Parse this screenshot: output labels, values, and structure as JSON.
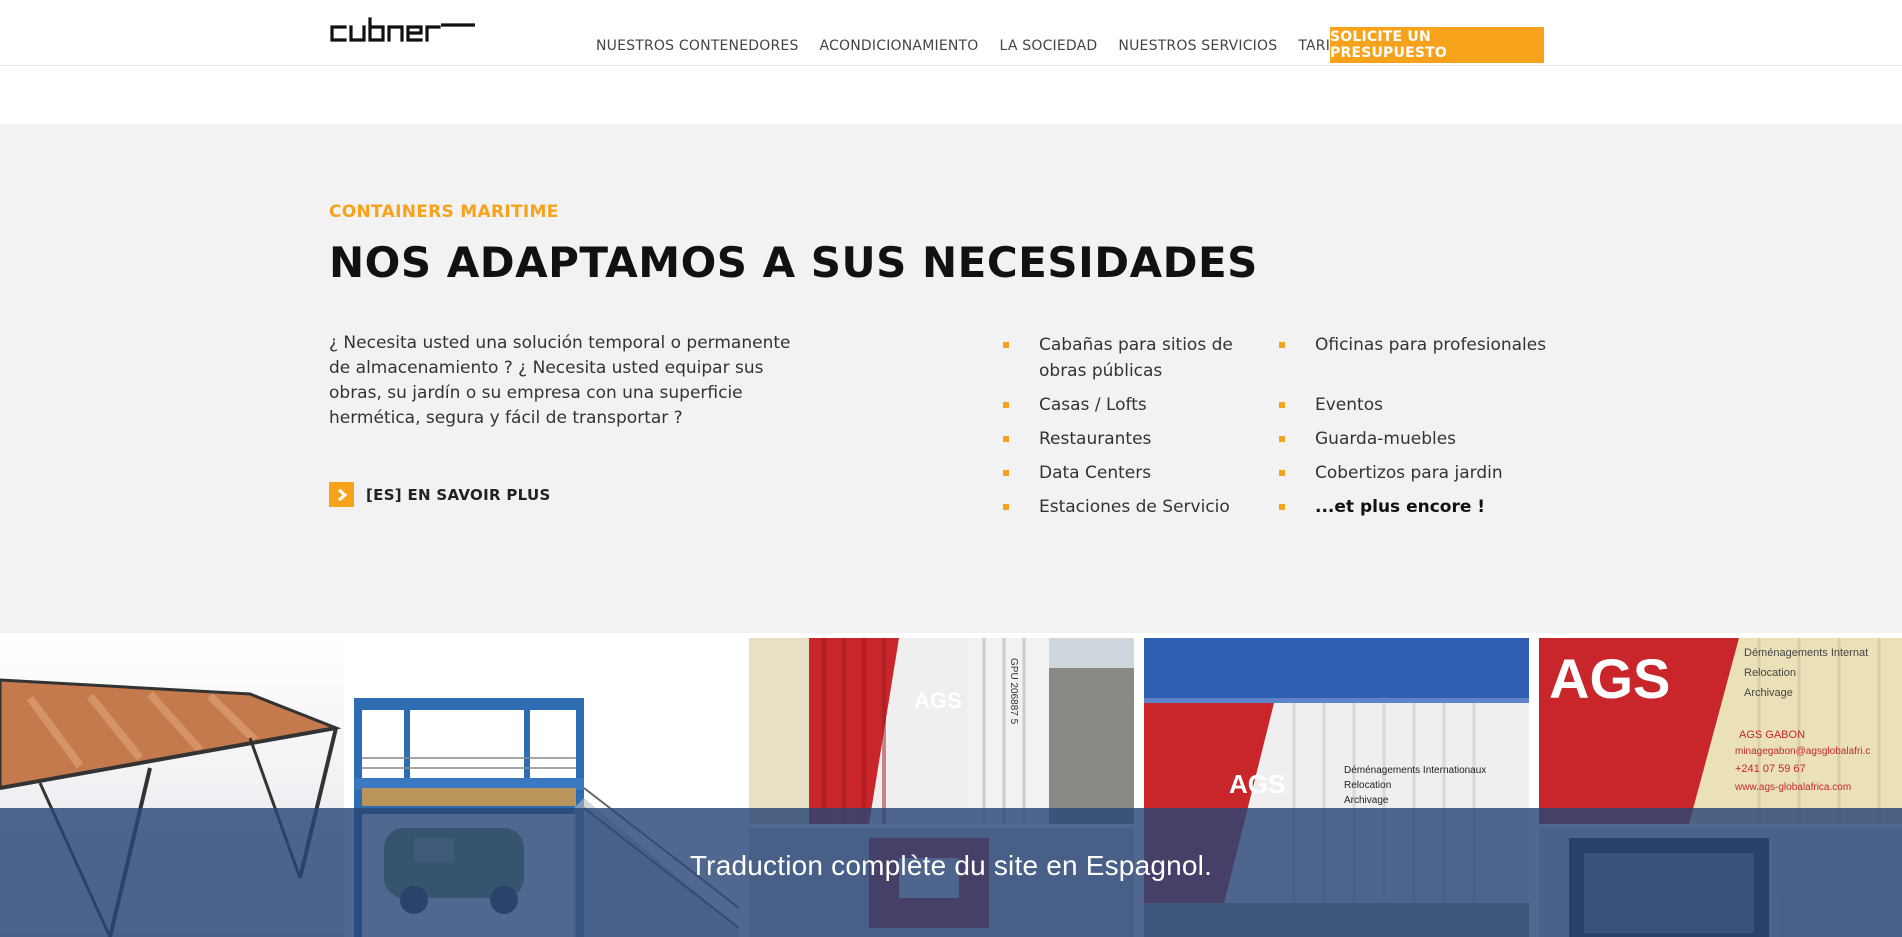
{
  "header": {
    "logo_text": "cubner",
    "nav": [
      "NUESTROS CONTENEDORES",
      "ACONDICIONAMIENTO",
      "LA SOCIEDAD",
      "NUESTROS SERVICIOS",
      "TARIFAS"
    ],
    "cta_label": "SOLICITE UN PRESUPUESTO"
  },
  "section": {
    "eyebrow": "CONTAINERS MARITIME",
    "headline": "NOS ADAPTAMOS A SUS NECESIDADES",
    "intro": "¿ Necesita usted una solución temporal o permanente de almacenamiento ? ¿ Necesita usted equipar sus obras, su jardín o su empresa con una superficie hermética, segura y fácil de transportar ?",
    "read_more": "[ES] EN SAVOIR PLUS",
    "list_col1": [
      "Cabañas para sitios de obras públicas",
      "Casas / Lofts",
      "Restaurantes",
      "Data Centers",
      "Estaciones de Servicio"
    ],
    "list_col2": [
      "Oficinas para profesionales",
      "Eventos",
      "Guarda-muebles",
      "Cobertizos para jardin",
      "...et plus encore !"
    ]
  },
  "gallery": {
    "tile3_brand": "AGS",
    "tile3_code": "GPU 206887 5",
    "tile4_brand": "AGS",
    "tile4_lines": [
      "Déménagements Internationaux",
      "Relocation",
      "Archivage"
    ],
    "tile5_brand": "AGS",
    "tile5_lines": [
      "Déménagements Internat",
      "Relocation",
      "Archivage"
    ],
    "tile5_small": [
      "AGS GABON",
      "minagegabon@agsglobalafri.c",
      "+241 07 59 67",
      "www.ags-globalafrica.com"
    ]
  },
  "banner": {
    "text": "Traduction complète du site en Espagnol."
  },
  "colors": {
    "accent": "#f7a21b",
    "section_bg": "#f2f2f2",
    "banner_bg": "#294576"
  }
}
